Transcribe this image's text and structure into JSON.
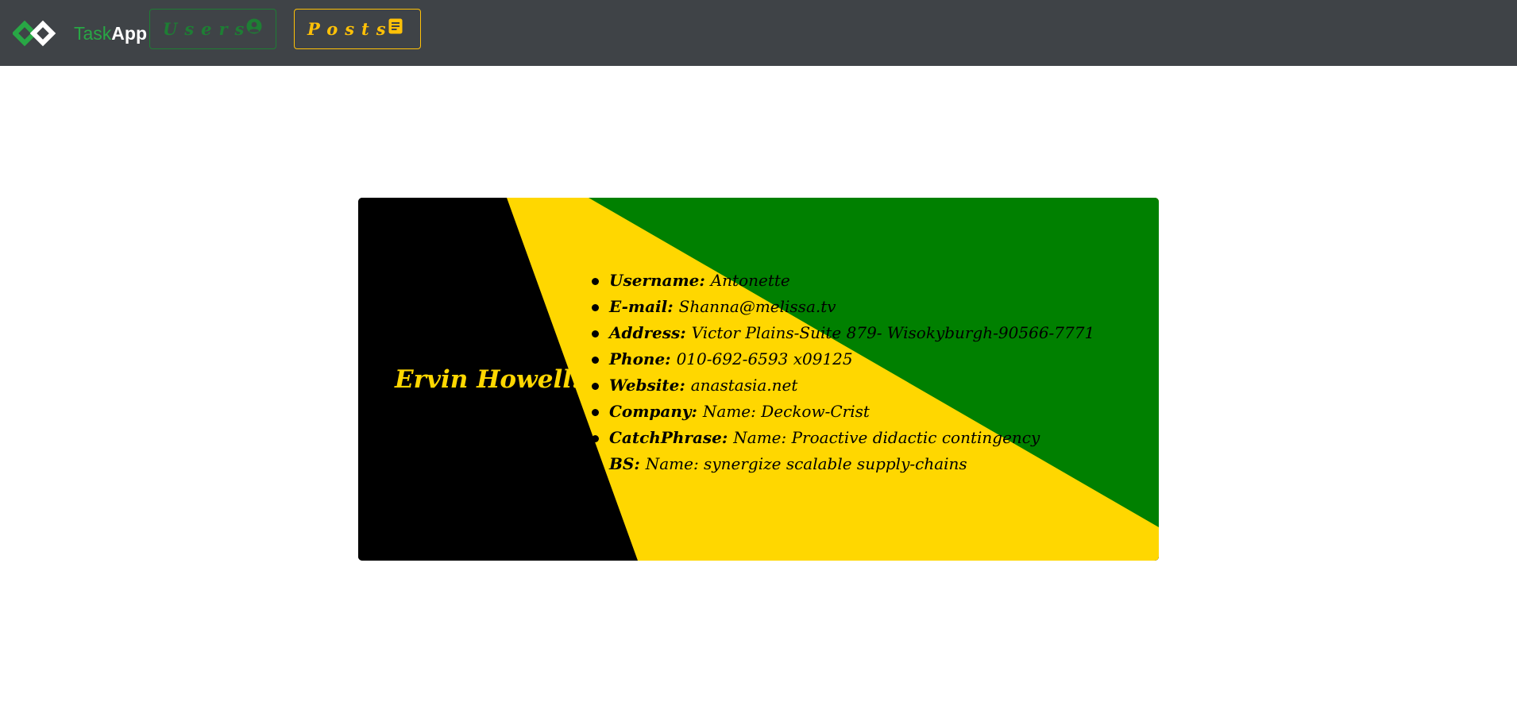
{
  "navbar": {
    "brand_task": "Task",
    "brand_app": "App",
    "logo_icon": "infinity-diamonds-logo",
    "users_label": "Users",
    "users_icon": "user-circle-icon",
    "posts_label": "Posts",
    "posts_icon": "document-icon"
  },
  "colors": {
    "navbar_bg": "#3f4347",
    "brand_green": "#28a745",
    "users_accent": "#1e7e34",
    "posts_accent": "#ffc107",
    "card_black": "#000000",
    "card_yellow": "#ffd700",
    "card_green": "#008000"
  },
  "card": {
    "name": "Ervin Howell:",
    "fields": [
      {
        "key": "Username:",
        "value": "Antonette"
      },
      {
        "key": "E-mail:",
        "value": "Shanna@melissa.tv"
      },
      {
        "key": "Address:",
        "value": "Victor Plains-Suite 879- Wisokyburgh-90566-7771"
      },
      {
        "key": "Phone:",
        "value": "010-692-6593 x09125"
      },
      {
        "key": "Website:",
        "value": "anastasia.net"
      },
      {
        "key": "Company:",
        "value": "Name: Deckow-Crist"
      },
      {
        "key": "CatchPhrase:",
        "value": "Name: Proactive didactic contingency"
      },
      {
        "key": "BS:",
        "value": "Name: synergize scalable supply-chains"
      }
    ]
  }
}
